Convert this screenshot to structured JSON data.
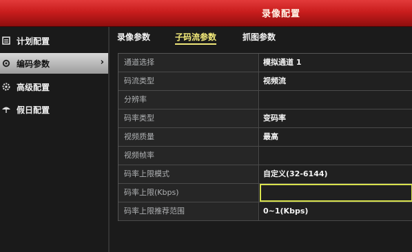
{
  "window": {
    "title": "录像配置"
  },
  "sidebar": {
    "items": [
      {
        "label": "计划配置",
        "icon": "calendar-icon"
      },
      {
        "label": "编码参数",
        "icon": "gear-icon",
        "active": true
      },
      {
        "label": "高级配置",
        "icon": "settings-icon"
      },
      {
        "label": "假日配置",
        "icon": "umbrella-icon"
      }
    ],
    "arrow": "›"
  },
  "tabs": [
    {
      "label": "录像参数"
    },
    {
      "label": "子码流参数",
      "active": true
    },
    {
      "label": "抓图参数"
    }
  ],
  "form": {
    "rows": [
      {
        "label": "通道选择",
        "value": "模拟通道 1"
      },
      {
        "label": "码流类型",
        "value": "视频流"
      },
      {
        "label": "分辨率",
        "value": ""
      },
      {
        "label": "码率类型",
        "value": "变码率"
      },
      {
        "label": "视频质量",
        "value": "最高"
      },
      {
        "label": "视频帧率",
        "value": ""
      },
      {
        "label": "码率上限模式",
        "value": "自定义(32-6144)"
      },
      {
        "label": "码率上限(Kbps)",
        "value": ""
      },
      {
        "label": "码率上限推荐范围",
        "value": "0~1(Kbps)"
      }
    ]
  },
  "colors": {
    "titlebar": "#c91d1d",
    "active_tab": "#f3ea7a",
    "focus_border": "#d9e34d"
  }
}
